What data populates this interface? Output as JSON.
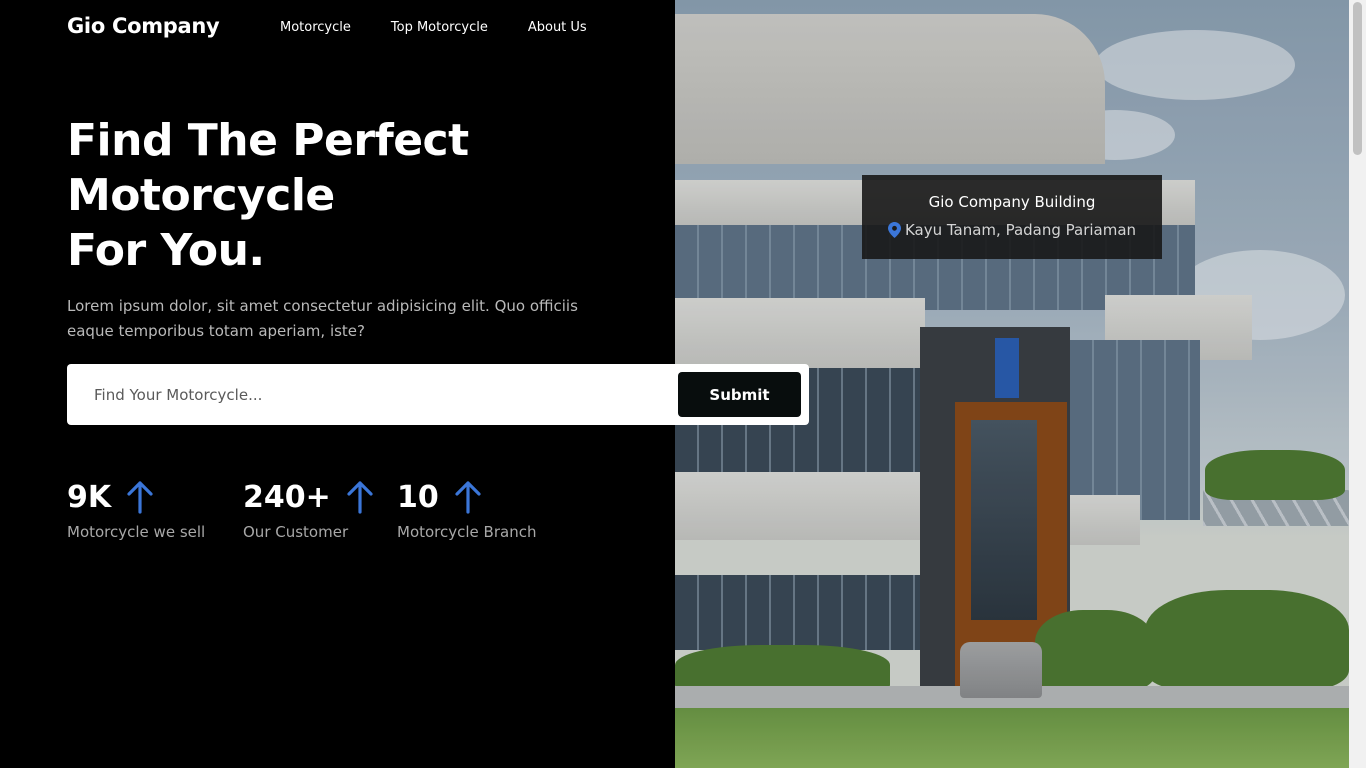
{
  "header": {
    "brand": "Gio Company",
    "nav": [
      "Motorcycle",
      "Top Motorcycle",
      "About Us"
    ]
  },
  "hero": {
    "title_lines": [
      "Find The Perfect",
      "Motorcycle",
      "For You."
    ],
    "description": "Lorem ipsum dolor, sit amet consectetur adipisicing elit. Quo officiis eaque temporibus totam aperiam, iste?",
    "search_placeholder": "Find Your Motorcycle...",
    "submit_label": "Submit"
  },
  "stats": [
    {
      "value": "9K",
      "label": "Motorcycle we sell",
      "icon": "arrow-up-icon"
    },
    {
      "value": "240+",
      "label": "Our Customer",
      "icon": "arrow-up-icon"
    },
    {
      "value": "10",
      "label": "Motorcycle Branch",
      "icon": "arrow-up-icon"
    }
  ],
  "location_card": {
    "title": "Gio Company Building",
    "address": "Kayu Tanam, Padang Pariaman",
    "icon": "map-pin-icon"
  },
  "colors": {
    "background": "#000000",
    "accent_blue": "#3b76d8",
    "submit_bg": "#080d0d"
  }
}
